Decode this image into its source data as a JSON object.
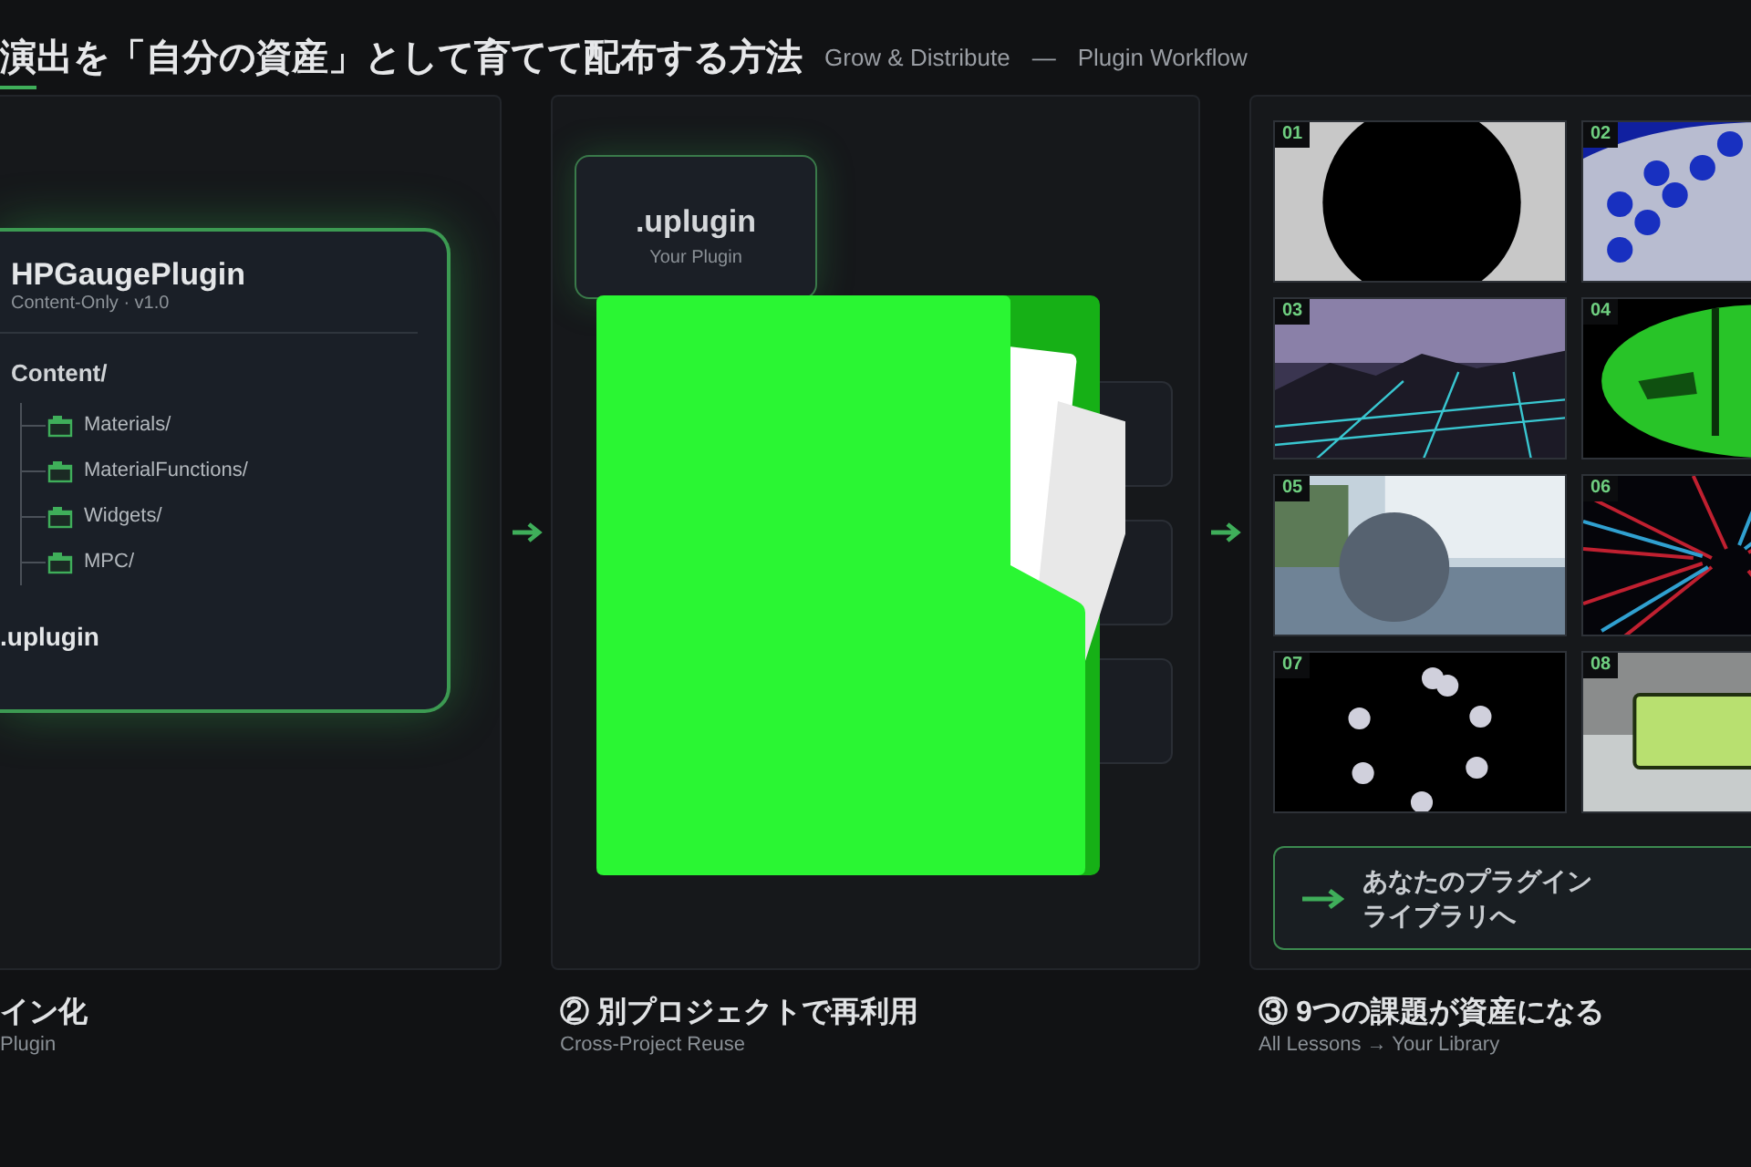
{
  "header": {
    "title": "演出を「自分の資産」として育てて配布する方法",
    "subtitle_en": "Grow & Distribute",
    "separator": "—",
    "subtitle_2": "Plugin Workflow"
  },
  "steps": [
    {
      "kind": "package",
      "caption": "イン化",
      "caption_en": "Plugin",
      "card": {
        "title": "HPGaugePlugin",
        "subtitle": "Content-Only · v1.0",
        "tree": [
          {
            "label": "Content/",
            "children": [
              {
                "label": "Materials/"
              },
              {
                "label": "MaterialFunctions/"
              },
              {
                "label": "Widgets/"
              },
              {
                "label": "MPC/"
              }
            ]
          }
        ],
        "footer": ".uplugin"
      }
    },
    {
      "kind": "reuse",
      "caption": "② 別プロジェクトで再利用",
      "caption_en": "Cross-Project Reuse",
      "card": {
        "title": ".uplugin",
        "subtitle": "Your Plugin"
      }
    },
    {
      "kind": "library",
      "caption": "③ 9つの課題が資産になる",
      "caption_en": "All Lessons → Your Library",
      "thumbnails": [
        {
          "label": "01"
        },
        {
          "label": "02"
        },
        {
          "label": "03"
        },
        {
          "label": "04"
        },
        {
          "label": "05"
        },
        {
          "label": "06"
        },
        {
          "label": "07"
        },
        {
          "label": "08"
        }
      ],
      "button_lines": [
        "あなたのプラグイン",
        "ライブラリへ"
      ]
    }
  ]
}
